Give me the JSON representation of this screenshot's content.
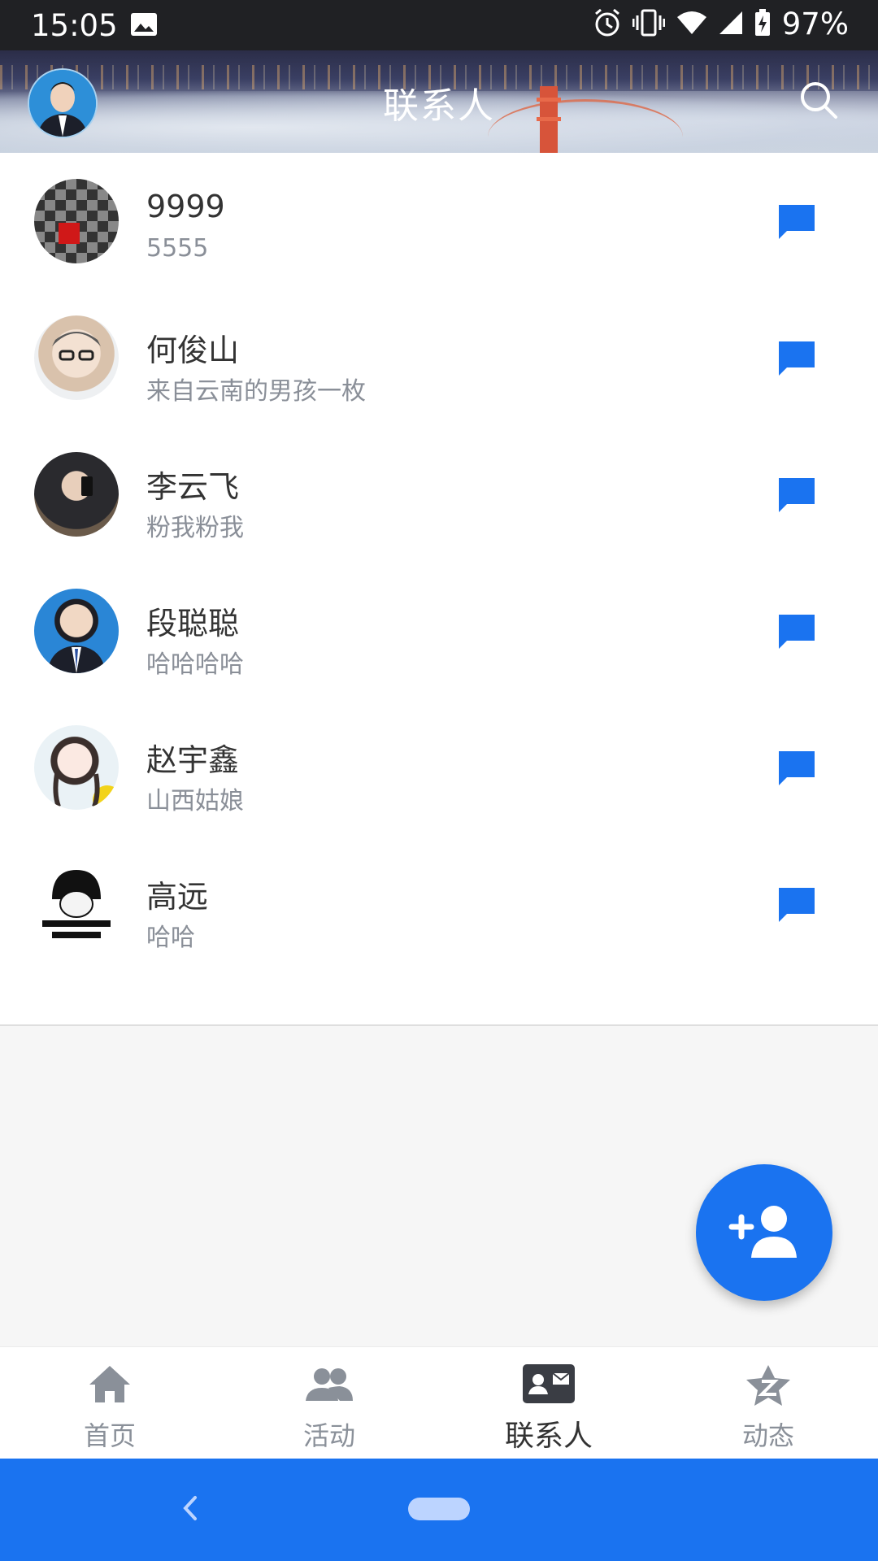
{
  "status_bar": {
    "time": "15:05",
    "battery_percent": "97%",
    "icons": [
      "image-icon",
      "alarm-icon",
      "vibrate-icon",
      "wifi-icon",
      "signal-icon",
      "battery-charging-icon"
    ]
  },
  "header": {
    "title": "联系人",
    "icons": [
      "profile-avatar",
      "search-icon"
    ]
  },
  "contacts": [
    {
      "name": "9999",
      "subtitle": "5555",
      "action_icon": "message-icon"
    },
    {
      "name": "何俊山",
      "subtitle": "来自云南的男孩一枚",
      "action_icon": "message-icon"
    },
    {
      "name": "李云飞",
      "subtitle": "粉我粉我",
      "action_icon": "message-icon"
    },
    {
      "name": "段聪聪",
      "subtitle": "哈哈哈哈",
      "action_icon": "message-icon"
    },
    {
      "name": "赵宇鑫",
      "subtitle": "山西姑娘",
      "action_icon": "message-icon"
    },
    {
      "name": "高远",
      "subtitle": "哈哈",
      "action_icon": "message-icon"
    }
  ],
  "fab": {
    "icon": "add-person-icon"
  },
  "bottom_nav": [
    {
      "label": "首页",
      "icon": "home-icon",
      "active": false
    },
    {
      "label": "活动",
      "icon": "people-icon",
      "active": false
    },
    {
      "label": "联系人",
      "icon": "contact-card-icon",
      "active": true
    },
    {
      "label": "动态",
      "icon": "star-z-icon",
      "active": false
    }
  ],
  "colors": {
    "accent": "#1a73f0",
    "status_bar": "#202124",
    "text_primary": "#333333",
    "text_secondary": "#8a8f98"
  }
}
